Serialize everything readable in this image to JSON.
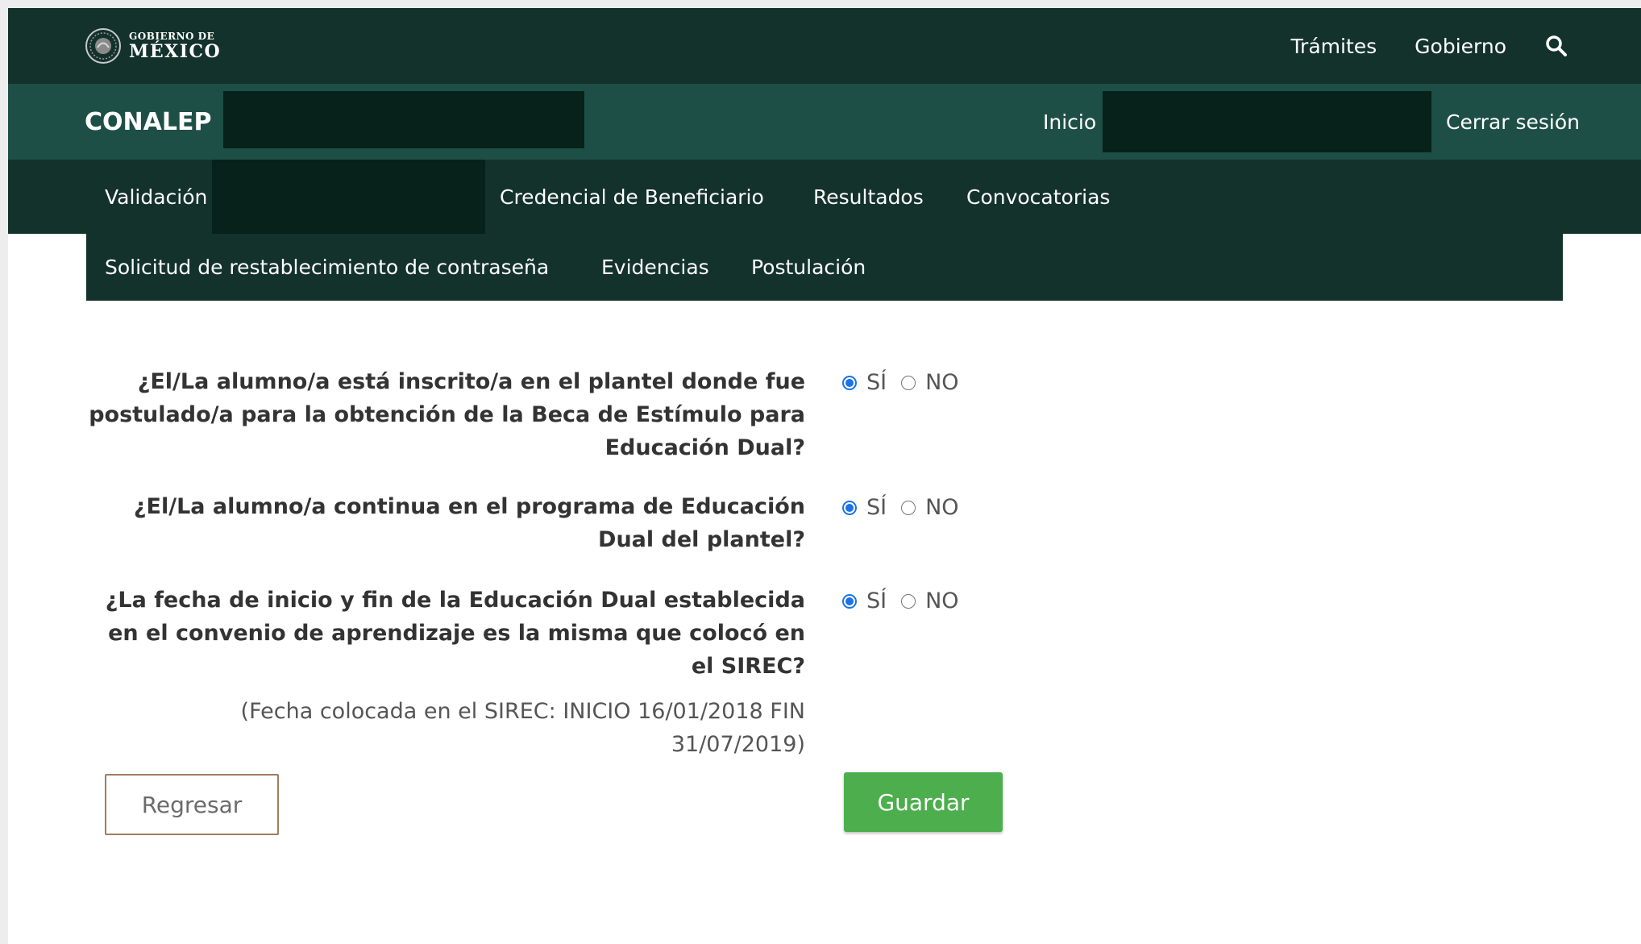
{
  "gov_header": {
    "logo_small": "GOBIERNO DE",
    "logo_big": "MÉXICO",
    "nav": {
      "tramites": "Trámites",
      "gobierno": "Gobierno"
    },
    "search_icon": "search-icon"
  },
  "app_header": {
    "title": "CONALEP",
    "inicio": "Inicio",
    "logout": "Cerrar sesión"
  },
  "menu": {
    "row1": [
      "Validación",
      "Credencial de Beneficiario",
      "Resultados",
      "Convocatorias"
    ],
    "row2": [
      "Solicitud de restablecimiento de contraseña",
      "Evidencias",
      "Postulación"
    ]
  },
  "form": {
    "questions": [
      {
        "text": "¿El/La alumno/a está inscrito/a en el plantel donde fue postulado/a para la obtención de la Beca de Estímulo para Educación Dual?",
        "selected": "SÍ"
      },
      {
        "text": "¿El/La alumno/a continua en el programa de Educación Dual del plantel?",
        "selected": "SÍ"
      },
      {
        "text": "¿La fecha de inicio y fin de la Educación Dual establecida en el convenio de aprendizaje es la misma que colocó en el SIREC?",
        "selected": "SÍ"
      }
    ],
    "option_yes": "SÍ",
    "option_no": "NO",
    "sirec_note": "(Fecha colocada en el SIREC: INICIO 16/01/2018 FIN 31/07/2019)"
  },
  "buttons": {
    "back": "Regresar",
    "save": "Guardar"
  },
  "colors": {
    "gov_bar": "#13322b",
    "app_bar": "#1e4f46",
    "save_button": "#4cae4c",
    "back_border": "#9d7d63",
    "radio_accent": "#1a73e8"
  }
}
